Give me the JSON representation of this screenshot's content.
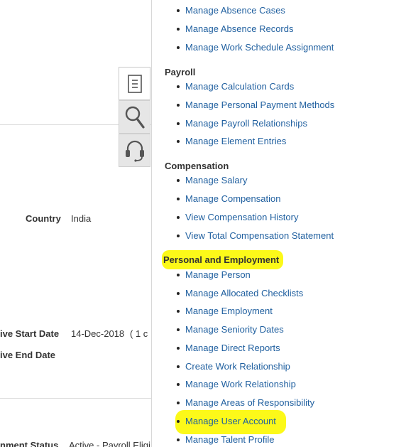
{
  "form": {
    "country_label": "Country",
    "country_value": "India",
    "start_date_label": "ive Start Date",
    "start_date_value": "14-Dec-2018",
    "start_date_extra": "(    1 c",
    "end_date_label": "ive End Date",
    "assignment_status_label": "nment Status",
    "assignment_status_value": "Active - Payroll Eligi"
  },
  "tools": [
    {
      "name": "tasks",
      "icon": "list-icon",
      "active": true
    },
    {
      "name": "search",
      "icon": "search-icon",
      "active": false
    },
    {
      "name": "help",
      "icon": "headset-icon",
      "active": false
    }
  ],
  "menu": {
    "top_items": [
      "Manage Absence Cases",
      "Manage Absence Records",
      "Manage Work Schedule Assignment"
    ],
    "payroll": {
      "title": "Payroll",
      "items": [
        "Manage Calculation Cards",
        "Manage Personal Payment Methods",
        "Manage Payroll Relationships",
        "Manage Element Entries"
      ]
    },
    "compensation": {
      "title": "Compensation",
      "items": [
        "Manage Salary",
        "Manage Compensation",
        "View Compensation History",
        "View Total Compensation Statement"
      ]
    },
    "personal": {
      "title": "Personal and Employment",
      "items": [
        "Manage Person",
        "Manage Allocated Checklists",
        "Manage Employment",
        "Manage Seniority Dates",
        "Manage Direct Reports",
        "Create Work Relationship",
        "Manage Work Relationship",
        "Manage Areas of Responsibility",
        "Manage User Account",
        "Manage Talent Profile"
      ]
    }
  },
  "colors": {
    "link": "#1f5f9f",
    "highlight": "#fcf919",
    "heading": "#333333"
  }
}
